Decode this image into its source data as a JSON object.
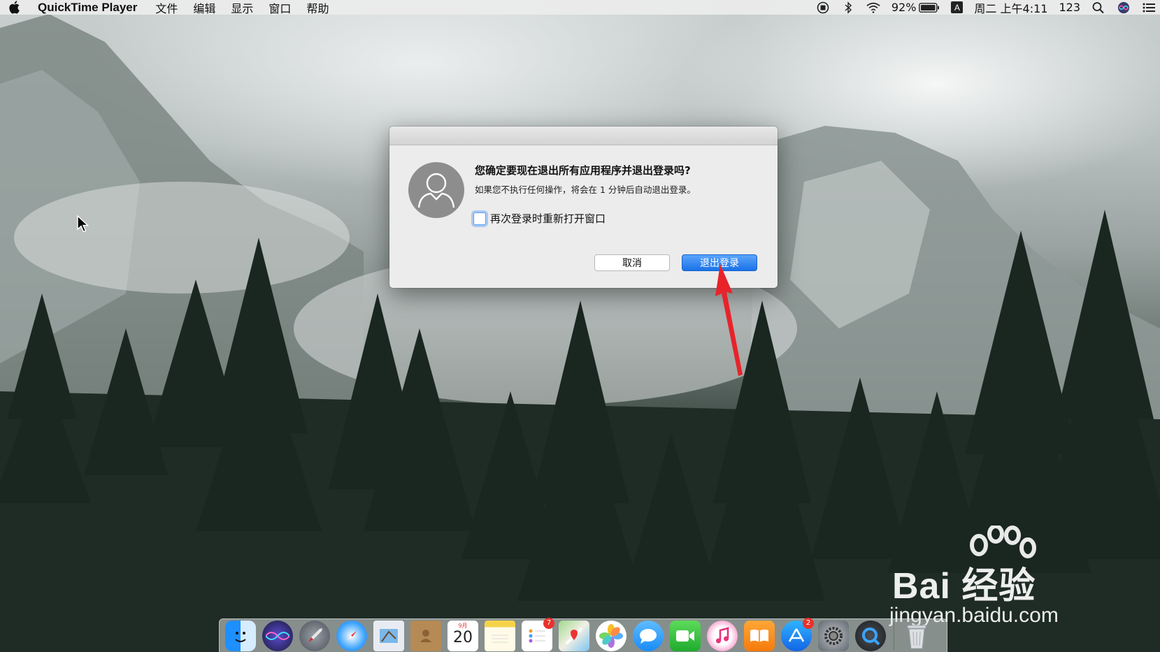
{
  "menubar": {
    "app_name": "QuickTime Player",
    "menus": [
      "文件",
      "编辑",
      "显示",
      "窗口",
      "帮助"
    ],
    "battery": "92%",
    "input_method": "A",
    "clock": "周二 上午4:11",
    "user_label": "123"
  },
  "dialog": {
    "title": "您确定要现在退出所有应用程序并退出登录吗?",
    "message": "如果您不执行任何操作，将会在 1 分钟后自动退出登录。",
    "checkbox_label": "再次登录时重新打开窗口",
    "checkbox_checked": false,
    "cancel_label": "取消",
    "logout_label": "退出登录"
  },
  "dock": {
    "calendar_month": "9月",
    "calendar_day": "20",
    "reminders_badge": "7",
    "appstore_badge": "2"
  },
  "watermark": {
    "brand": "Bai 经验",
    "site": "jingyan.baidu.com"
  },
  "colors": {
    "accent": "#1a72e8",
    "annotation_arrow": "#e8232a"
  }
}
